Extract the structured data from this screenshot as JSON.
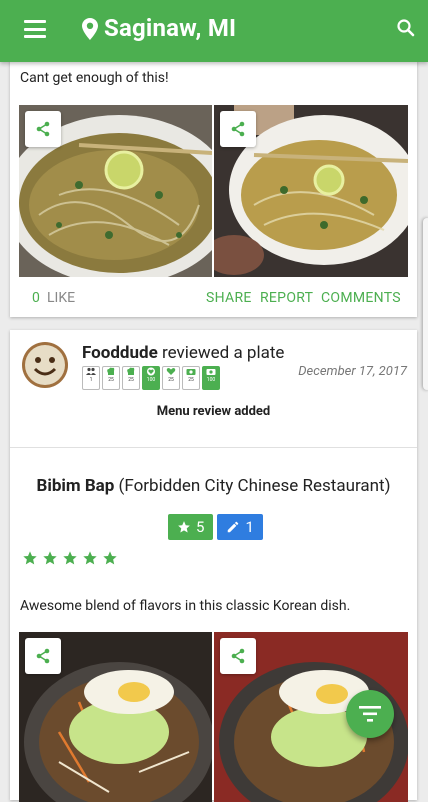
{
  "header": {
    "location": "Saginaw, MI"
  },
  "post1": {
    "caption": "Cant get enough of this!",
    "like_count": "0",
    "like_label": "LIKE",
    "share_label": "SHARE",
    "report_label": "REPORT",
    "comments_label": "COMMENTS"
  },
  "post2": {
    "reviewer_name": "Fooddude",
    "action_text": " reviewed a plate",
    "date": "December 17, 2017",
    "badges": [
      {
        "icon": "people-icon",
        "value": "1"
      },
      {
        "icon": "chef-hat-icon",
        "value": "25"
      },
      {
        "icon": "chef-hat-icon",
        "value": "25"
      },
      {
        "icon": "heart-icon",
        "value": "100"
      },
      {
        "icon": "heart-icon",
        "value": "25"
      },
      {
        "icon": "camera-icon",
        "value": "25"
      },
      {
        "icon": "camera-icon",
        "value": "100"
      }
    ],
    "status": "Menu review added",
    "dish_name": "Bibim Bap",
    "restaurant": " (Forbidden City Chinese Restaurant)",
    "rating_count": "5",
    "edit_count": "1",
    "rating_stars": 5,
    "review": "Awesome blend of flavors in this classic Korean dish."
  },
  "colors": {
    "accent": "#4caf50",
    "blue": "#2f7de0"
  }
}
